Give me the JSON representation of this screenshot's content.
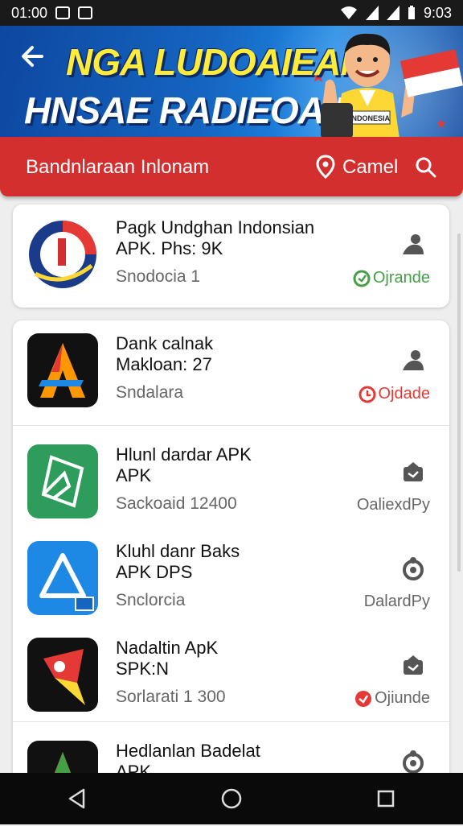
{
  "status_bar": {
    "time": "01:00",
    "right_time": "9:03"
  },
  "banner": {
    "title_line1": "NGA LUDOAIEAN",
    "title_line2": "HNSAE RADIEOAII",
    "badge_text": "INDONESIA"
  },
  "search": {
    "text": "Bandnlaraan Inlonam",
    "label": "Camel"
  },
  "apps": [
    {
      "title": "Pagk Undghan Indonsian",
      "subtitle": "APK. Phs: 9K",
      "meta": "Snodocia  1",
      "action": "Ojrande",
      "action_color": "#43a047"
    },
    {
      "title": "Dank calnak",
      "subtitle": "Makloan: 27",
      "meta": "Sndalara",
      "action": "Ojdade",
      "action_color": "#e53935"
    },
    {
      "title": "Hlunl dardar APK",
      "subtitle": "APK",
      "meta": "Sackoaid  12400",
      "action": "OaliexdPy",
      "action_color": "#666666"
    },
    {
      "title": "Kluhl danr Baks",
      "subtitle": "APK DPS",
      "meta": "Snclorcia",
      "action": "DalardPy",
      "action_color": "#666666"
    },
    {
      "title": "Nadaltin ApK",
      "subtitle": "SPK:N",
      "meta": "Sorlarati  1 300",
      "action": "Ojiunde",
      "action_color": "#e53935"
    },
    {
      "title": "Hedlanlan Badelat",
      "subtitle": "APK",
      "meta": "",
      "action": "",
      "action_color": "#666666"
    }
  ],
  "colors": {
    "header_red": "#d32f2f",
    "banner_blue": "#1565c0",
    "green": "#43a047",
    "red": "#e53935"
  }
}
